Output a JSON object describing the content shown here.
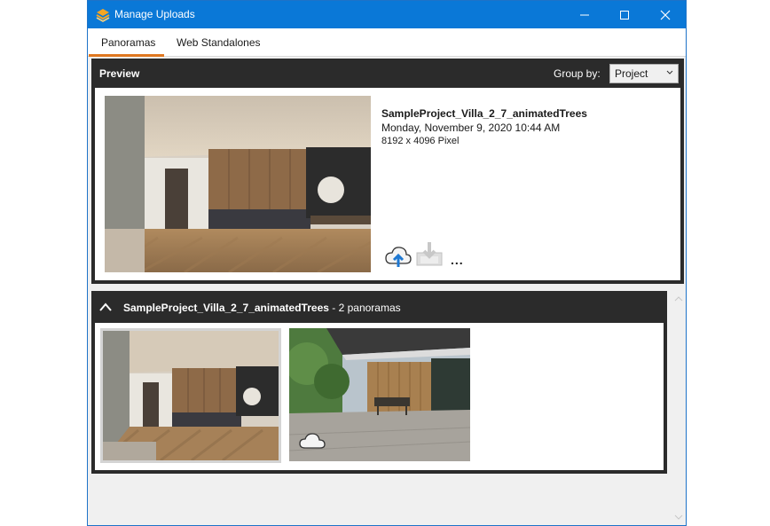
{
  "window": {
    "title": "Manage Uploads"
  },
  "tabs": [
    {
      "label": "Panoramas",
      "active": true
    },
    {
      "label": "Web Standalones",
      "active": false
    }
  ],
  "preview": {
    "title": "Preview",
    "group_by_label": "Group by:",
    "group_by_value": "Project",
    "item": {
      "name": "SampleProject_Villa_2_7_animatedTrees",
      "date": "Monday, November 9, 2020 10:44 AM",
      "resolution": "8192 x 4096  Pixel"
    },
    "more_label": "..."
  },
  "group": {
    "name": "SampleProject_Villa_2_7_animatedTrees",
    "count_text": " - 2 panoramas"
  },
  "colors": {
    "titlebar": "#0a78d7",
    "tab_accent": "#e07820",
    "panel_dark": "#2b2b2b"
  },
  "icons": [
    "app-logo-icon",
    "minimize-icon",
    "maximize-icon",
    "close-icon",
    "dropdown-chevron-icon",
    "cloud-upload-icon",
    "download-icon",
    "collapse-chevron-icon",
    "cloud-icon"
  ]
}
